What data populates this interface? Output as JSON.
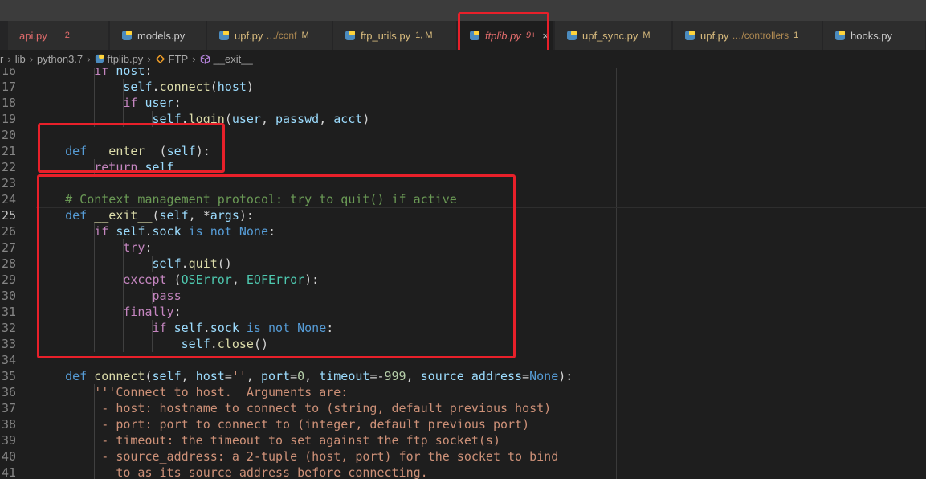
{
  "tabs": [
    {
      "name": "api.py",
      "desc": "",
      "badge": "2",
      "badge_color": "#e06c6c",
      "name_color": "#e06c6c"
    },
    {
      "name": "models.py",
      "desc": "",
      "badge": "",
      "badge_color": "",
      "name_color": "#cccccc"
    },
    {
      "name": "upf.py",
      "desc": "…/conf",
      "badge": "M",
      "badge_color": "#d7ba7d",
      "name_color": "#d7ba7d"
    },
    {
      "name": "ftp_utils.py",
      "desc": "",
      "badge": "1, M",
      "badge_color": "#d7ba7d",
      "name_color": "#d7ba7d"
    },
    {
      "name": "ftplib.py",
      "desc": "",
      "badge": "9+",
      "badge_color": "#e06c6c",
      "name_color": "#e06c6c",
      "close": "×"
    },
    {
      "name": "upf_sync.py",
      "desc": "",
      "badge": "M",
      "badge_color": "#d7ba7d",
      "name_color": "#d7ba7d"
    },
    {
      "name": "upf.py",
      "desc": "…/controllers",
      "badge": "1",
      "badge_color": "#d7ba7d",
      "name_color": "#d7ba7d"
    },
    {
      "name": "hooks.py",
      "desc": "",
      "badge": "",
      "badge_color": "",
      "name_color": "#cccccc"
    }
  ],
  "breadcrumb": {
    "items": [
      "r",
      "lib",
      "python3.7",
      "ftplib.py",
      "FTP",
      "__exit__"
    ],
    "separator": "›"
  },
  "lines": [
    {
      "num": "16",
      "indent": 2,
      "tokens": [
        [
          "k",
          "if "
        ],
        [
          "v",
          "host"
        ],
        [
          "p",
          ":"
        ]
      ]
    },
    {
      "num": "17",
      "indent": 3,
      "tokens": [
        [
          "v",
          "self"
        ],
        [
          "p",
          "."
        ],
        [
          "f",
          "connect"
        ],
        [
          "p",
          "("
        ],
        [
          "v",
          "host"
        ],
        [
          "p",
          ")"
        ]
      ]
    },
    {
      "num": "18",
      "indent": 3,
      "tokens": [
        [
          "k",
          "if "
        ],
        [
          "v",
          "user"
        ],
        [
          "p",
          ":"
        ]
      ]
    },
    {
      "num": "19",
      "indent": 4,
      "tokens": [
        [
          "v",
          "self"
        ],
        [
          "p",
          "."
        ],
        [
          "f",
          "login"
        ],
        [
          "p",
          "("
        ],
        [
          "v",
          "user"
        ],
        [
          "p",
          ", "
        ],
        [
          "v",
          "passwd"
        ],
        [
          "p",
          ", "
        ],
        [
          "v",
          "acct"
        ],
        [
          "p",
          ")"
        ]
      ]
    },
    {
      "num": "20",
      "indent": 0,
      "tokens": []
    },
    {
      "num": "21",
      "indent": 1,
      "tokens": [
        [
          "d",
          "def "
        ],
        [
          "f",
          "__enter__"
        ],
        [
          "p",
          "("
        ],
        [
          "v",
          "self"
        ],
        [
          "p",
          "):"
        ]
      ]
    },
    {
      "num": "22",
      "indent": 2,
      "tokens": [
        [
          "k",
          "return "
        ],
        [
          "v",
          "self"
        ]
      ]
    },
    {
      "num": "23",
      "indent": 0,
      "tokens": []
    },
    {
      "num": "24",
      "indent": 1,
      "tokens": [
        [
          "c",
          "# Context management protocol: try to quit() if active"
        ]
      ]
    },
    {
      "num": "25",
      "indent": 1,
      "tokens": [
        [
          "d",
          "def "
        ],
        [
          "f",
          "__exit__"
        ],
        [
          "p",
          "("
        ],
        [
          "v",
          "self"
        ],
        [
          "p",
          ", *"
        ],
        [
          "v",
          "args"
        ],
        [
          "p",
          "):"
        ]
      ]
    },
    {
      "num": "26",
      "indent": 2,
      "tokens": [
        [
          "k",
          "if "
        ],
        [
          "v",
          "self"
        ],
        [
          "p",
          "."
        ],
        [
          "v",
          "sock"
        ],
        [
          "d",
          " is not "
        ],
        [
          "d",
          "None"
        ],
        [
          "p",
          ":"
        ]
      ]
    },
    {
      "num": "27",
      "indent": 3,
      "tokens": [
        [
          "k",
          "try"
        ],
        [
          "p",
          ":"
        ]
      ]
    },
    {
      "num": "28",
      "indent": 4,
      "tokens": [
        [
          "v",
          "self"
        ],
        [
          "p",
          "."
        ],
        [
          "f",
          "quit"
        ],
        [
          "p",
          "()"
        ]
      ]
    },
    {
      "num": "29",
      "indent": 3,
      "tokens": [
        [
          "k",
          "except "
        ],
        [
          "p",
          "("
        ],
        [
          "t",
          "OSError"
        ],
        [
          "p",
          ", "
        ],
        [
          "t",
          "EOFError"
        ],
        [
          "p",
          "):"
        ]
      ]
    },
    {
      "num": "30",
      "indent": 4,
      "tokens": [
        [
          "k",
          "pass"
        ]
      ]
    },
    {
      "num": "31",
      "indent": 3,
      "tokens": [
        [
          "k",
          "finally"
        ],
        [
          "p",
          ":"
        ]
      ]
    },
    {
      "num": "32",
      "indent": 4,
      "tokens": [
        [
          "k",
          "if "
        ],
        [
          "v",
          "self"
        ],
        [
          "p",
          "."
        ],
        [
          "v",
          "sock"
        ],
        [
          "d",
          " is not "
        ],
        [
          "d",
          "None"
        ],
        [
          "p",
          ":"
        ]
      ]
    },
    {
      "num": "33",
      "indent": 5,
      "tokens": [
        [
          "v",
          "self"
        ],
        [
          "p",
          "."
        ],
        [
          "f",
          "close"
        ],
        [
          "p",
          "()"
        ]
      ]
    },
    {
      "num": "34",
      "indent": 0,
      "tokens": []
    },
    {
      "num": "35",
      "indent": 1,
      "tokens": [
        [
          "d",
          "def "
        ],
        [
          "f",
          "connect"
        ],
        [
          "p",
          "("
        ],
        [
          "v",
          "self"
        ],
        [
          "p",
          ", "
        ],
        [
          "v",
          "host"
        ],
        [
          "p",
          "="
        ],
        [
          "s",
          "''"
        ],
        [
          "p",
          ", "
        ],
        [
          "v",
          "port"
        ],
        [
          "p",
          "="
        ],
        [
          "n",
          "0"
        ],
        [
          "p",
          ", "
        ],
        [
          "v",
          "timeout"
        ],
        [
          "p",
          "=-"
        ],
        [
          "n",
          "999"
        ],
        [
          "p",
          ", "
        ],
        [
          "v",
          "source_address"
        ],
        [
          "p",
          "="
        ],
        [
          "d",
          "None"
        ],
        [
          "p",
          "):"
        ]
      ]
    },
    {
      "num": "36",
      "indent": 2,
      "tokens": [
        [
          "s",
          "'''Connect to host.  Arguments are:"
        ]
      ]
    },
    {
      "num": "37",
      "indent": 2,
      "tokens": [
        [
          "s",
          " - host: hostname to connect to (string, default previous host)"
        ]
      ]
    },
    {
      "num": "38",
      "indent": 2,
      "tokens": [
        [
          "s",
          " - port: port to connect to (integer, default previous port)"
        ]
      ]
    },
    {
      "num": "39",
      "indent": 2,
      "tokens": [
        [
          "s",
          " - timeout: the timeout to set against the ftp socket(s)"
        ]
      ]
    },
    {
      "num": "40",
      "indent": 2,
      "tokens": [
        [
          "s",
          " - source_address: a 2-tuple (host, port) for the socket to bind"
        ]
      ]
    },
    {
      "num": "41",
      "indent": 2,
      "tokens": [
        [
          "s",
          "   to as its source address before connecting."
        ]
      ]
    }
  ],
  "current_line": "25",
  "colors": {
    "highlight": "#e8202a",
    "background": "#1e1e1e"
  }
}
